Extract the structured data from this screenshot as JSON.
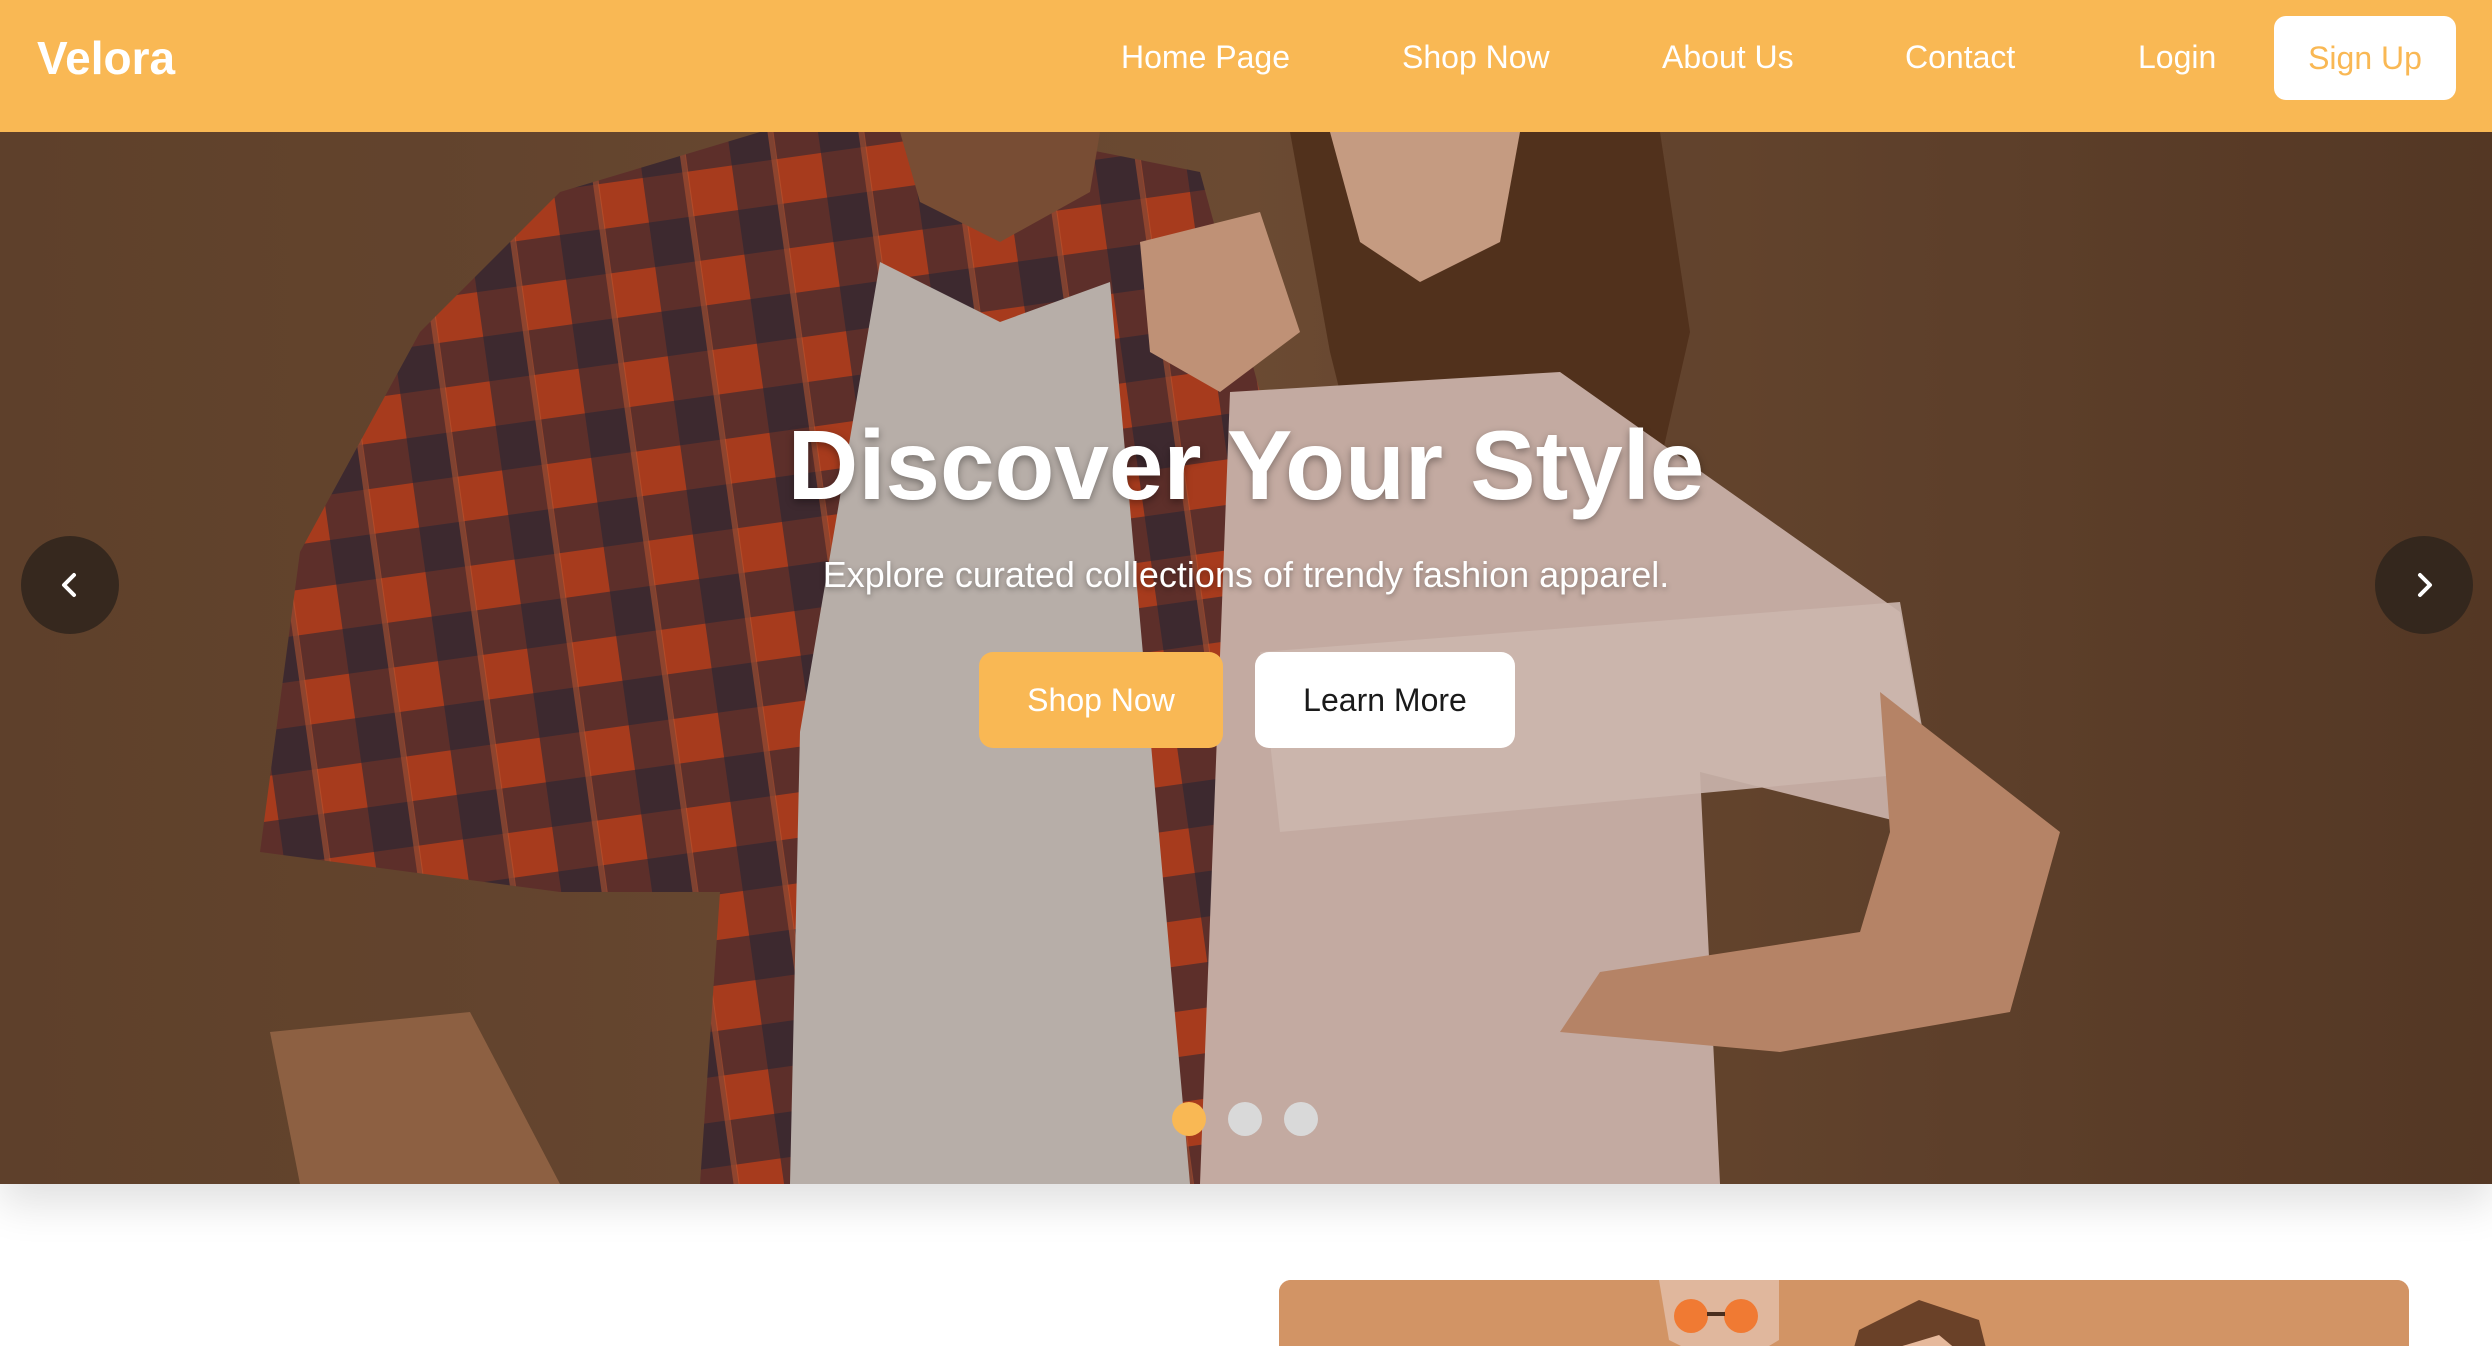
{
  "brand": {
    "name": "Velora",
    "accent": "#f9b854"
  },
  "nav": {
    "items": [
      {
        "label": "Home Page"
      },
      {
        "label": "Shop Now"
      },
      {
        "label": "About Us"
      },
      {
        "label": "Contact"
      },
      {
        "label": "Login"
      }
    ],
    "signup_label": "Sign Up"
  },
  "hero": {
    "title": "Discover Your Style",
    "subtitle": "Explore curated collections of trendy fashion apparel.",
    "primary_button": "Shop Now",
    "secondary_button": "Learn More",
    "prev_icon": "chevron-left-icon",
    "next_icon": "chevron-right-icon",
    "slides_total": 3,
    "active_slide": 1
  }
}
